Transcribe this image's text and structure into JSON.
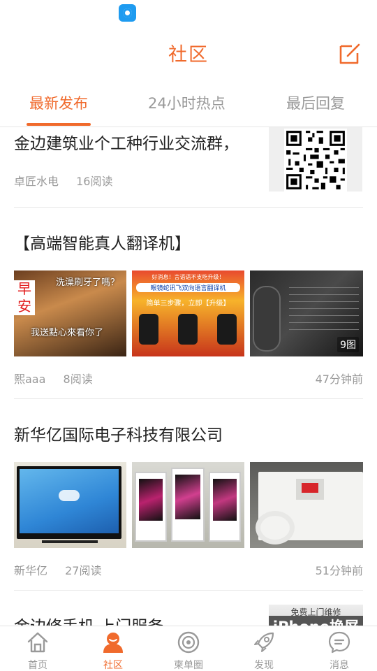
{
  "header": {
    "title": "社区"
  },
  "tabs": [
    {
      "label": "最新发布",
      "active": true
    },
    {
      "label": "24小时热点",
      "active": false
    },
    {
      "label": "最后回复",
      "active": false
    }
  ],
  "posts": [
    {
      "title": "金边建筑业个工种行业交流群，",
      "author": "卓匠水电",
      "reads": "16阅读",
      "time": ""
    },
    {
      "title": "【高端智能真人翻译机】",
      "author": "熙aaa",
      "reads": "8阅读",
      "time": "47分钟前",
      "images": [
        {
          "icon": "boy-meme-image",
          "text_lines": [
            "早",
            "安"
          ],
          "caption_top": "洗澡刷牙了嗎？",
          "caption_bottom": "我送點心來看你了"
        },
        {
          "icon": "translator-ad-image",
          "banner1": "好消息！言语语不支吃升级！",
          "banner2": "眼镜蛇讯飞双向语言翻译机",
          "banner3": "简单三步骤，立即【升级】"
        },
        {
          "icon": "translator-device-image",
          "badge": "9图"
        }
      ]
    },
    {
      "title": "新华亿国际电子科技有限公司",
      "author": "新华亿",
      "reads": "27阅读",
      "time": "51分钟前",
      "images": [
        {
          "icon": "tv-image"
        },
        {
          "icon": "display-stand-image"
        },
        {
          "icon": "air-conditioner-image"
        }
      ]
    },
    {
      "title": "金边修手机 上门服务",
      "thumb_text": "iPhone换屏",
      "thumb_sub": "免费上门维修"
    }
  ],
  "bottom_nav": [
    {
      "label": "首页",
      "icon": "home-icon",
      "active": false
    },
    {
      "label": "社区",
      "icon": "community-icon",
      "active": true
    },
    {
      "label": "柬单圈",
      "icon": "circle-icon",
      "active": false
    },
    {
      "label": "发现",
      "icon": "rocket-icon",
      "active": false
    },
    {
      "label": "消息",
      "icon": "message-icon",
      "active": false
    }
  ],
  "colors": {
    "accent": "#f06a2c",
    "muted": "#999999",
    "divider": "#e8e8e8"
  }
}
